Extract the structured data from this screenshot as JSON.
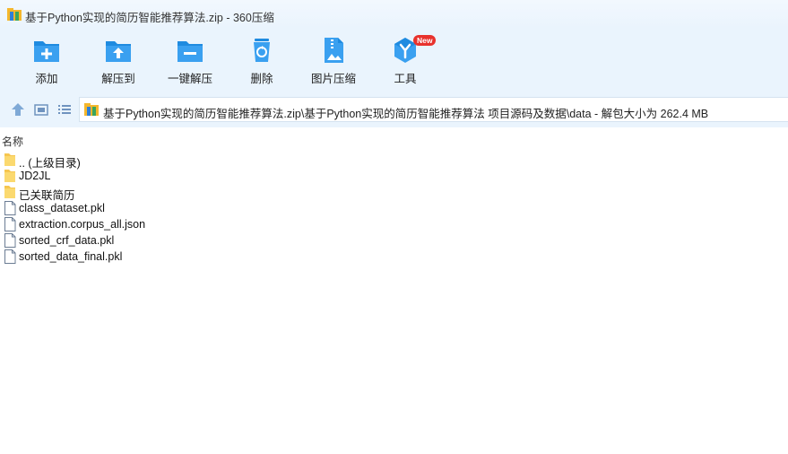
{
  "window": {
    "title": "基于Python实现的简历智能推荐算法.zip - 360压缩"
  },
  "toolbar": {
    "items": [
      {
        "label": "添加",
        "icon": "add-icon"
      },
      {
        "label": "解压到",
        "icon": "extract-to-icon"
      },
      {
        "label": "一键解压",
        "icon": "one-click-extract-icon"
      },
      {
        "label": "删除",
        "icon": "delete-icon"
      },
      {
        "label": "图片压缩",
        "icon": "image-compress-icon"
      },
      {
        "label": "工具",
        "icon": "tools-icon",
        "badge": "New"
      }
    ]
  },
  "navbar": {
    "path": "基于Python实现的简历智能推荐算法.zip\\基于Python实现的简历智能推荐算法 项目源码及数据\\data - 解包大小为 262.4 MB"
  },
  "file_list": {
    "column_name": "名称",
    "items": [
      {
        "name": ".. (上级目录)",
        "type": "folder"
      },
      {
        "name": "JD2JL",
        "type": "folder"
      },
      {
        "name": "已关联简历",
        "type": "folder"
      },
      {
        "name": "class_dataset.pkl",
        "type": "file"
      },
      {
        "name": "extraction.corpus_all.json",
        "type": "file"
      },
      {
        "name": "sorted_crf_data.pkl",
        "type": "file"
      },
      {
        "name": "sorted_data_final.pkl",
        "type": "file"
      }
    ]
  },
  "colors": {
    "toolbar_bg": "#eaf4fd",
    "icon_blue": "#1f8be0",
    "folder_yellow": "#f6c64f",
    "badge_red": "#e8322d"
  }
}
